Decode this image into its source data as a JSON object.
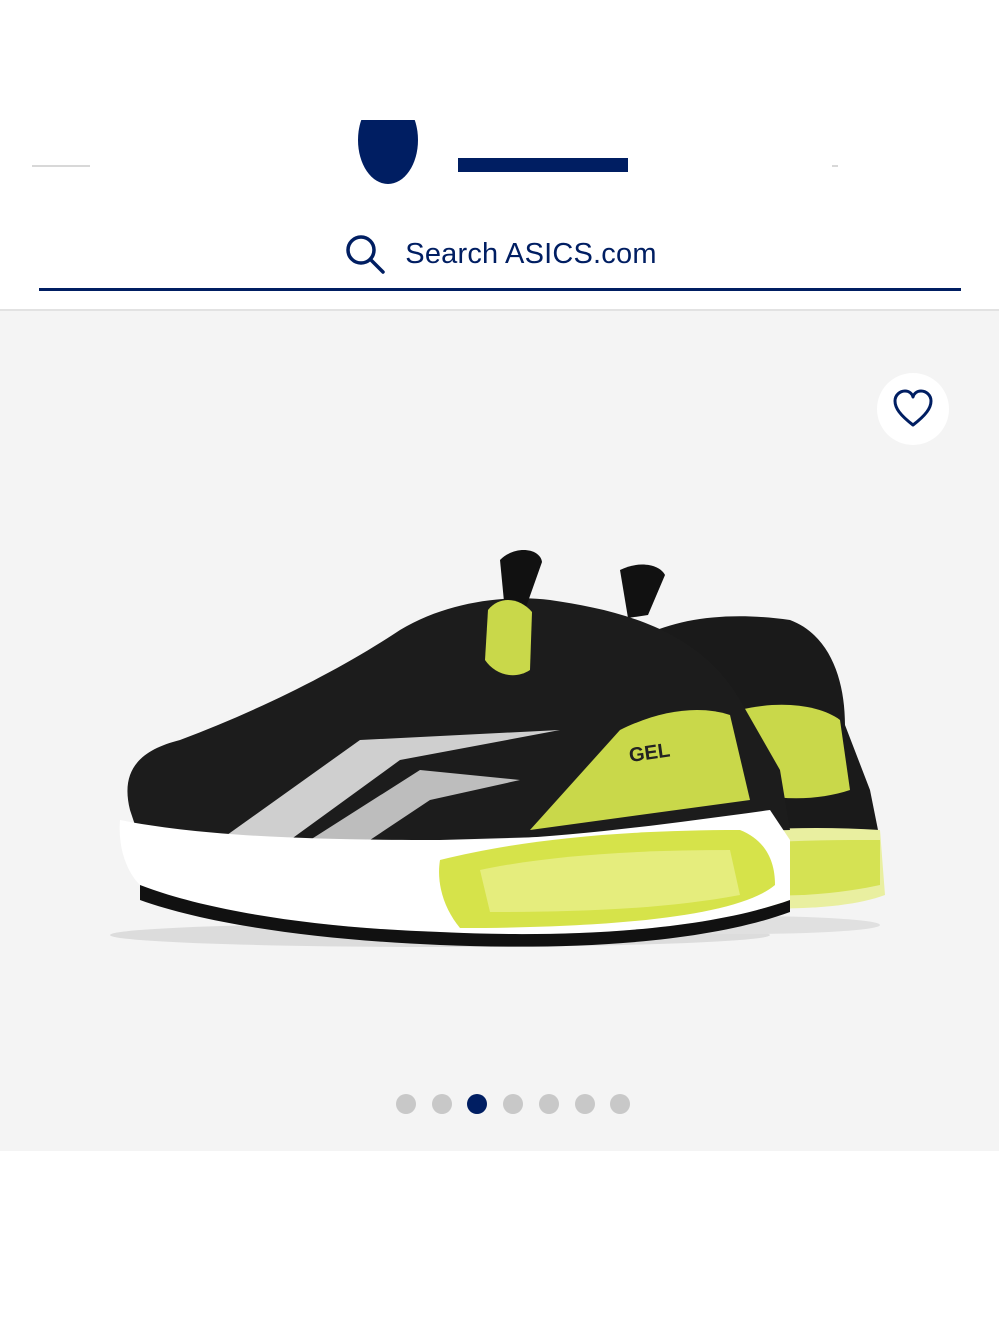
{
  "search": {
    "placeholder": "Search ASICS.com",
    "icon": "search-icon"
  },
  "favorite": {
    "icon": "heart-icon"
  },
  "gallery": {
    "slide_count": 7,
    "active_index": 2,
    "image_alt_icon": "product-shoe-image"
  },
  "colors": {
    "brand": "#001e62",
    "gallery_bg": "#f4f4f4",
    "dot_inactive": "#c8c8c8",
    "accent_lime": "#c9d84a"
  }
}
